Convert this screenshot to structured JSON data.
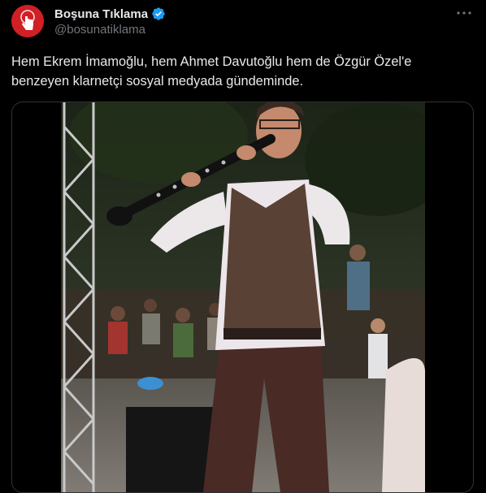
{
  "author": {
    "display_name": "Boşuna Tıklama",
    "handle": "@bosunatiklama",
    "avatar_icon": "hand-pointer-icon",
    "verified_icon": "verified-badge-icon"
  },
  "tweet": {
    "text_line1": "Hem Ekrem İmamoğlu, hem Ahmet Davutoğlu hem de Özgür Özel'e",
    "text_line2": "benzeyen klarnetçi sosyal medyada gündeminde."
  },
  "menu": {
    "icon": "more-options-icon"
  },
  "colors": {
    "background": "#000000",
    "text": "#e7e9ea",
    "secondary_text": "#71767b",
    "verified": "#1d9bf0",
    "avatar_bg": "#d11f26",
    "border": "#2f3336"
  }
}
